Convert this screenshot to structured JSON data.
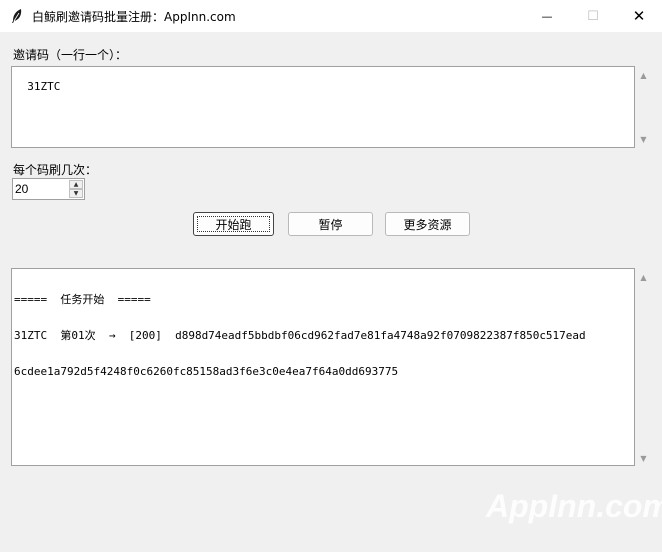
{
  "window": {
    "title": "白鲸刷邀请码批量注册：AppInn.com",
    "minimize_glyph": "—",
    "maximize_glyph": "☐",
    "close_glyph": "✕"
  },
  "invite": {
    "label": "邀请码（一行一个）：",
    "value": "31ZTC"
  },
  "repeat": {
    "label": "每个码刷几次：",
    "value": "20"
  },
  "buttons": {
    "start": "开始跑",
    "pause": "暂停",
    "more": "更多资源"
  },
  "log": {
    "line1": "=====  任务开始  =====",
    "line2": "31ZTC  第01次  →  [200]  d898d74eadf5bbdbf06cd962fad7e81fa4748a92f0709822387f850c517ead",
    "line3": "6cdee1a792d5f4248f0c6260fc85158ad3f6e3c0e4ea7f64a0dd693775"
  },
  "watermark": "AppInn.com",
  "icons": {
    "app": "feather-icon",
    "scroll_up": "scroll-up-arrow-icon",
    "scroll_down": "scroll-down-arrow-icon"
  }
}
